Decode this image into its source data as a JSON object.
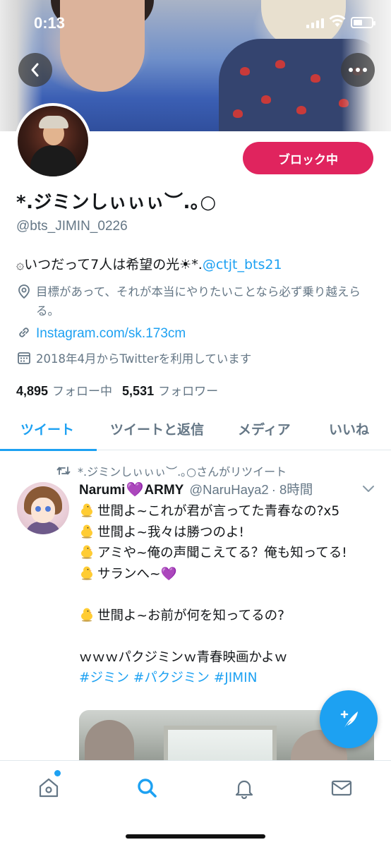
{
  "status_bar": {
    "time": "0:13"
  },
  "profile": {
    "display_name": "*.ジミンしぃぃぃ︶.｡○",
    "handle": "@bts_JIMIN_0226",
    "block_button_label": "ブロック中",
    "bio_prefix": "۞いつだって7人は希望の光☀︎*.",
    "bio_link": "@ctjt_bts21",
    "location": "目標があって、それが本当にやりたいことなら必ず乗り越えらる。",
    "website": "Instagram.com/sk.173cm",
    "joined": "2018年4月からTwitterを利用しています",
    "following_count": "4,895",
    "following_label": "フォロー中",
    "followers_count": "5,531",
    "followers_label": "フォロワー"
  },
  "tabs": [
    {
      "label": "ツイート",
      "active": true
    },
    {
      "label": "ツイートと返信",
      "active": false
    },
    {
      "label": "メディア",
      "active": false
    },
    {
      "label": "いいね",
      "active": false
    }
  ],
  "tweet": {
    "retweet_context": "*.ジミンしぃぃぃ︶.｡○さんがリツイート",
    "author_name": "Narumi",
    "author_heart": "💜",
    "author_suffix": "ARMY",
    "author_handle": "@NaruHaya2",
    "time": "· 8時間",
    "lines": [
      "世間よ~これが君が言ってた青春なの?x5",
      "世間よ~我々は勝つのよ!",
      "アミや~俺の声聞こえてる？俺も知ってる!",
      "サランへ~",
      "世間よ~お前が何を知ってるの?"
    ],
    "heart_end": "💜",
    "line_plain": "ｗｗｗパクジミンｗ青春映画かよｗ",
    "hashtags": "#ジミン #パクジミン #JIMIN"
  },
  "icons": {
    "back": "chevron-left-icon",
    "more": "more-icon",
    "location": "location-pin-icon",
    "link": "link-icon",
    "calendar": "calendar-icon",
    "retweet": "retweet-icon",
    "compose": "compose-icon",
    "home": "home-icon",
    "search": "search-icon",
    "notifications": "bell-icon",
    "messages": "envelope-icon"
  },
  "colors": {
    "accent": "#1da1f2",
    "block": "#e0245e",
    "secondary_text": "#657786"
  }
}
